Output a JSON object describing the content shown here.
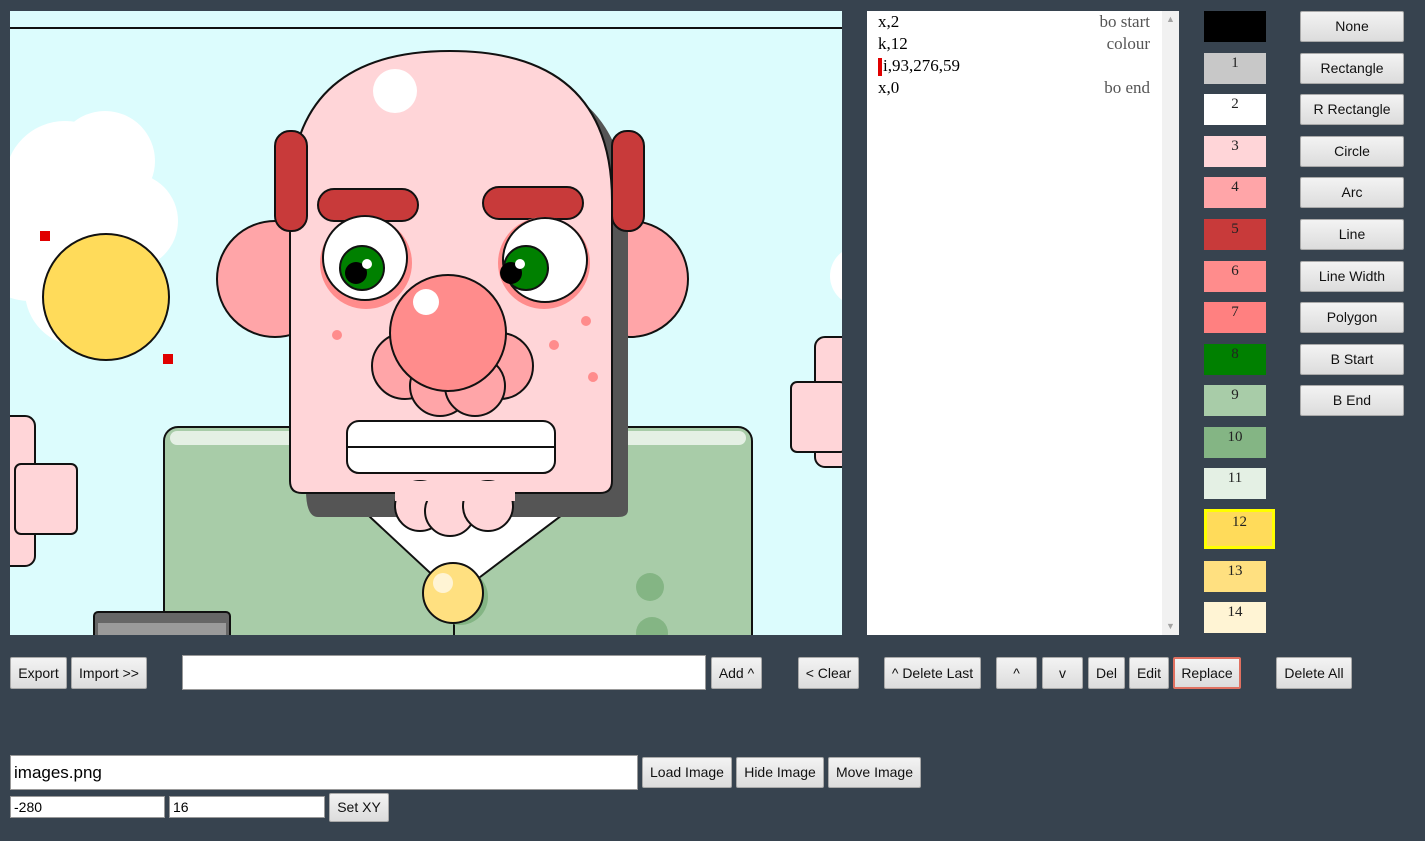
{
  "listbox": {
    "rows": [
      {
        "cmd": "x,2",
        "note": "bo start",
        "selected": false
      },
      {
        "cmd": "k,12",
        "note": "colour",
        "selected": false
      },
      {
        "cmd": "i,93,276,59",
        "note": "",
        "selected": true
      },
      {
        "cmd": "x,0",
        "note": "bo end",
        "selected": false
      }
    ]
  },
  "palette": [
    {
      "label": "",
      "color": "#000000"
    },
    {
      "label": "1",
      "color": "#c8c8c8"
    },
    {
      "label": "2",
      "color": "#ffffff"
    },
    {
      "label": "3",
      "color": "#ffd5d8"
    },
    {
      "label": "4",
      "color": "#ffa5a8"
    },
    {
      "label": "5",
      "color": "#c83a3a"
    },
    {
      "label": "6",
      "color": "#ff8c8c"
    },
    {
      "label": "7",
      "color": "#ff8080"
    },
    {
      "label": "8",
      "color": "#008000"
    },
    {
      "label": "9",
      "color": "#a8cca8"
    },
    {
      "label": "10",
      "color": "#84b584"
    },
    {
      "label": "11",
      "color": "#e4f0e4"
    },
    {
      "label": "12",
      "color": "#ffdb5a"
    },
    {
      "label": "13",
      "color": "#ffe080"
    },
    {
      "label": "14",
      "color": "#fff4d4"
    }
  ],
  "selected_swatch": "12",
  "tools": [
    "None",
    "Rectangle",
    "R Rectangle",
    "Circle",
    "Arc",
    "Line",
    "Line Width",
    "Polygon",
    "B Start",
    "B End"
  ],
  "bottom_bar": {
    "export": "Export",
    "import": "Import >>",
    "command_value": "",
    "add": "Add ^",
    "clear": "< Clear",
    "delete_last": "^ Delete Last",
    "up": "^",
    "down": "v",
    "del": "Del",
    "edit": "Edit",
    "replace": "Replace",
    "delete_all": "Delete All"
  },
  "image_bar": {
    "filename": "images.png",
    "load": "Load Image",
    "hide": "Hide Image",
    "move": "Move Image",
    "x_value": "-280",
    "y_value": "16",
    "set_xy": "Set XY"
  },
  "colors": {
    "background": "#37434f",
    "canvas_sky": "#dcfcfd",
    "accent_selection": "#ffff00",
    "handle": "#e00000"
  }
}
